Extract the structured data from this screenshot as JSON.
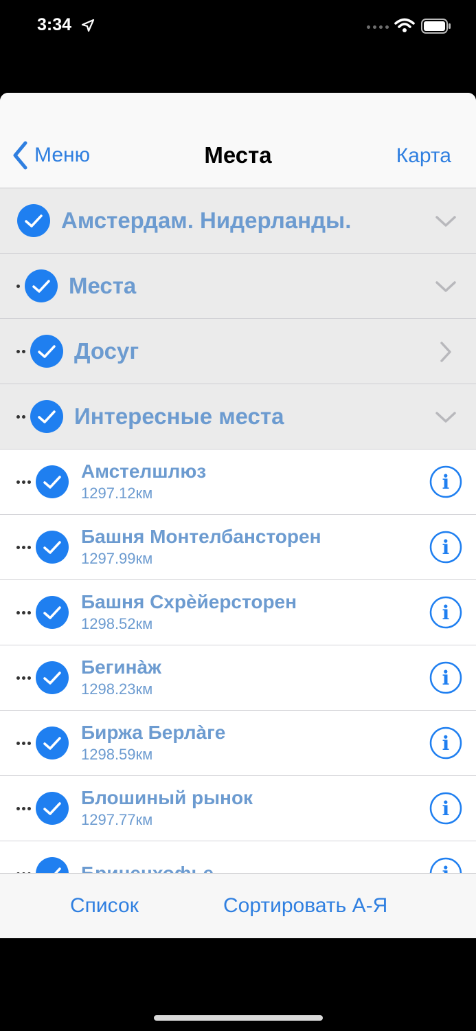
{
  "status_bar": {
    "time": "3:34"
  },
  "navbar": {
    "back_label": "Меню",
    "title": "Места",
    "right_label": "Карта"
  },
  "groups": [
    {
      "label": "Амстердам. Нидерланды.",
      "level": 0,
      "chevron": "chevron-down-icon"
    },
    {
      "label": "Места",
      "level": 1,
      "chevron": "chevron-down-icon"
    },
    {
      "label": "Досуг",
      "level": 2,
      "chevron": "chevron-right-icon"
    },
    {
      "label": "Интересные места",
      "level": 2,
      "chevron": "chevron-down-icon"
    }
  ],
  "items": [
    {
      "name": "Амстелшлюз",
      "distance": "1297.12км"
    },
    {
      "name": "Башня Монтелбансторен",
      "distance": "1297.99км"
    },
    {
      "name": "Башня Схрѐйерсторен",
      "distance": "1298.52км"
    },
    {
      "name": "Бегинàж",
      "distance": "1298.23км"
    },
    {
      "name": "Биржа Берлàге",
      "distance": "1298.59км"
    },
    {
      "name": "Блошиный рынок",
      "distance": "1297.77км"
    },
    {
      "name": "Бриненхофье",
      "distance": ""
    }
  ],
  "toolbar": {
    "list_label": "Список",
    "sort_label": "Сортировать А-Я"
  },
  "colors": {
    "accent": "#2f7fe0",
    "check": "#1f7ff0",
    "label": "#6c9bd0",
    "group_bg": "#ebebeb"
  }
}
